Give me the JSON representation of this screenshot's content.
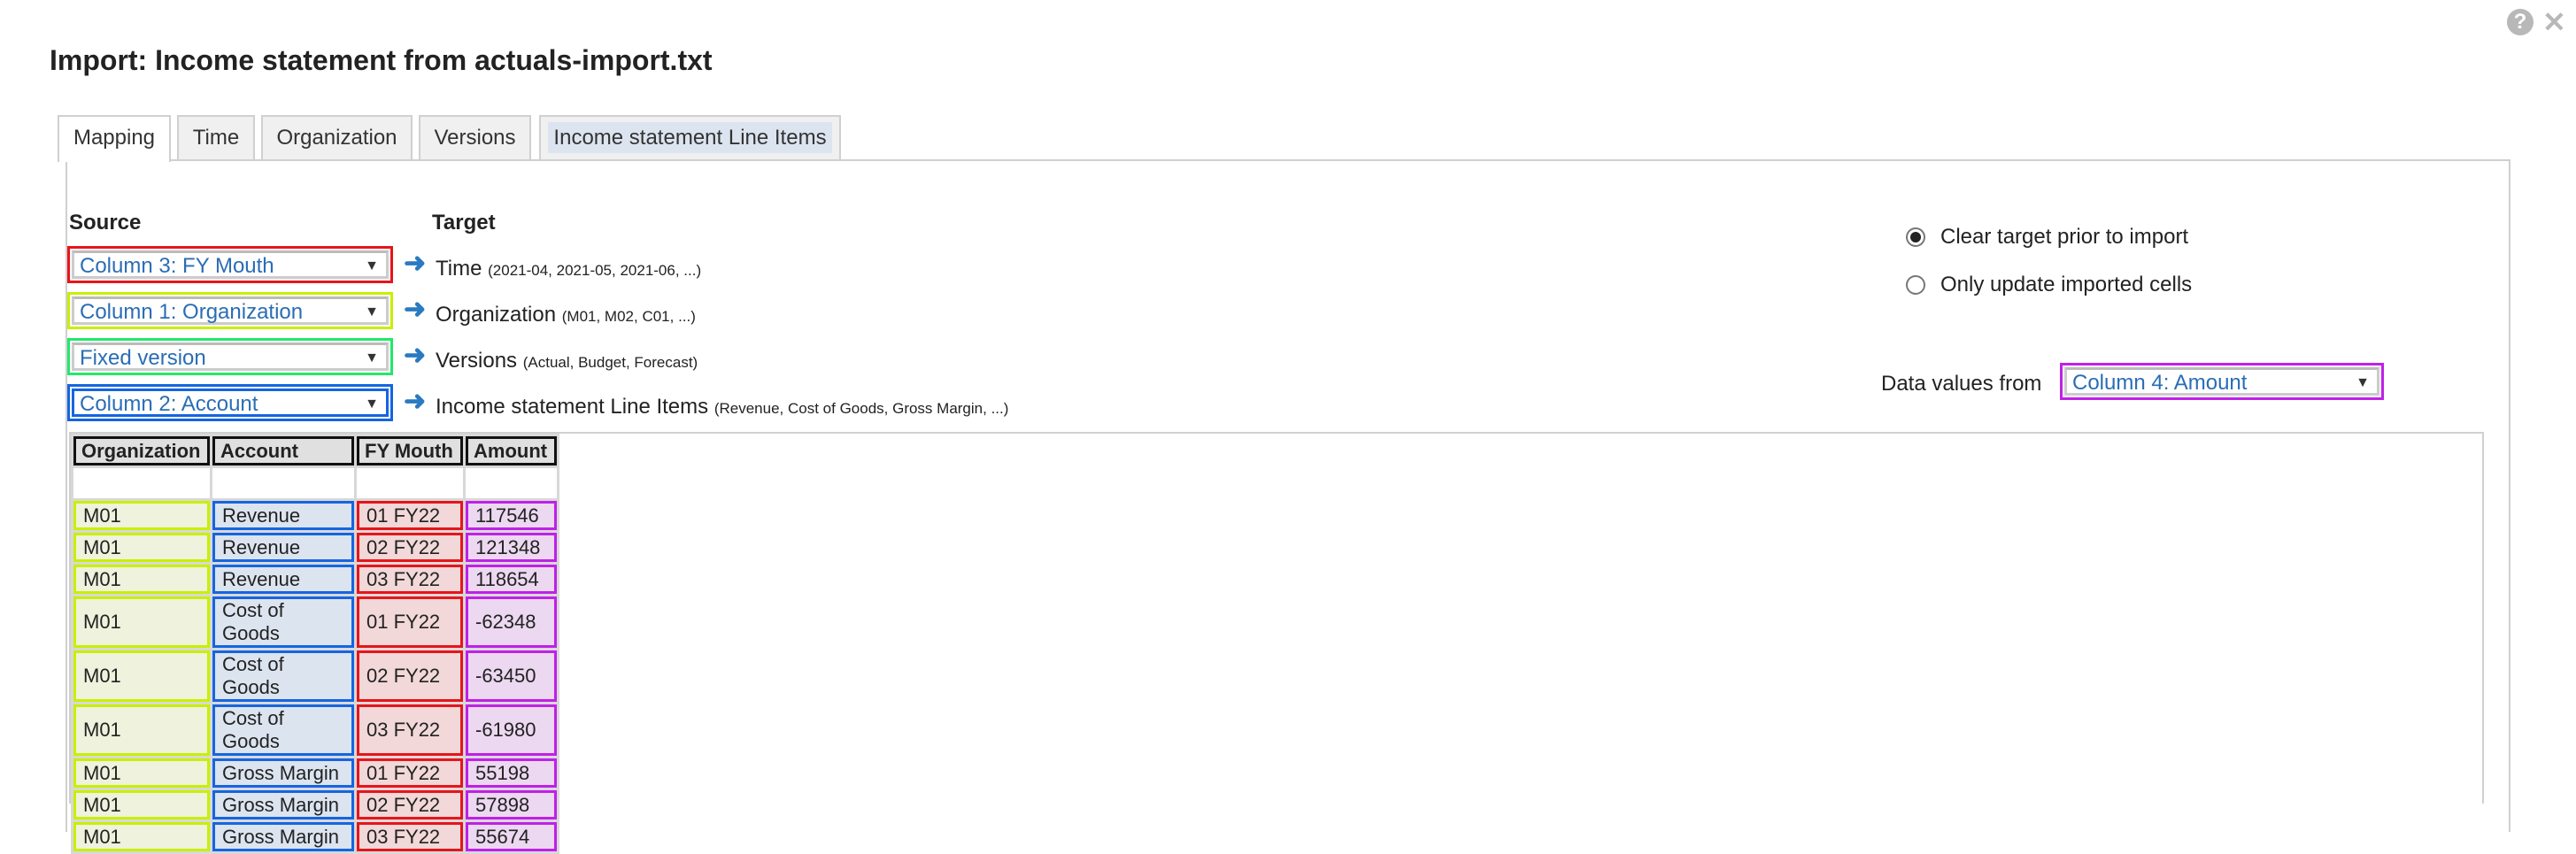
{
  "dialog": {
    "title": "Import: Income statement from actuals-import.txt",
    "help_icon": "?",
    "close_icon": "✕"
  },
  "tabs": [
    {
      "label": "Mapping",
      "active": true
    },
    {
      "label": "Time"
    },
    {
      "label": "Organization"
    },
    {
      "label": "Versions"
    },
    {
      "label": "Income statement Line Items",
      "highlighted": true
    }
  ],
  "mapping": {
    "source_label": "Source",
    "target_label": "Target",
    "rows": [
      {
        "source": "Column 3: FY Mouth",
        "color": "#e8141a",
        "target": "Time",
        "hint": "(2021-04, 2021-05, 2021-06, ...)"
      },
      {
        "source": "Column 1: Organization",
        "color": "#c8f000",
        "target": "Organization",
        "hint": "(M01, M02, C01, ...)"
      },
      {
        "source": "Fixed version",
        "color": "#22e86a",
        "target": "Versions",
        "hint": "(Actual, Budget, Forecast)"
      },
      {
        "source": "Column 2: Account",
        "color": "#1565e0",
        "target": "Income statement Line Items",
        "hint": "(Revenue, Cost of Goods, Gross Margin, ...)"
      }
    ]
  },
  "options": {
    "clear_target": "Clear target prior to import",
    "only_update": "Only update imported cells",
    "selected": "clear_target",
    "data_values_label": "Data values from",
    "data_values_select": "Column 4: Amount",
    "data_values_color": "#c020e8"
  },
  "preview": {
    "headers": [
      "Organization",
      "Account",
      "FY Mouth",
      "Amount"
    ],
    "rows": [
      [
        "M01",
        "Revenue",
        "01 FY22",
        "117546"
      ],
      [
        "M01",
        "Revenue",
        "02 FY22",
        "121348"
      ],
      [
        "M01",
        "Revenue",
        "03 FY22",
        "118654"
      ],
      [
        "M01",
        "Cost of Goods",
        "01 FY22",
        "-62348"
      ],
      [
        "M01",
        "Cost of Goods",
        "02 FY22",
        "-63450"
      ],
      [
        "M01",
        "Cost of Goods",
        "03 FY22",
        "-61980"
      ],
      [
        "M01",
        "Gross Margin",
        "01 FY22",
        "55198"
      ],
      [
        "M01",
        "Gross Margin",
        "02 FY22",
        "57898"
      ],
      [
        "M01",
        "Gross Margin",
        "03 FY22",
        "55674"
      ]
    ]
  }
}
